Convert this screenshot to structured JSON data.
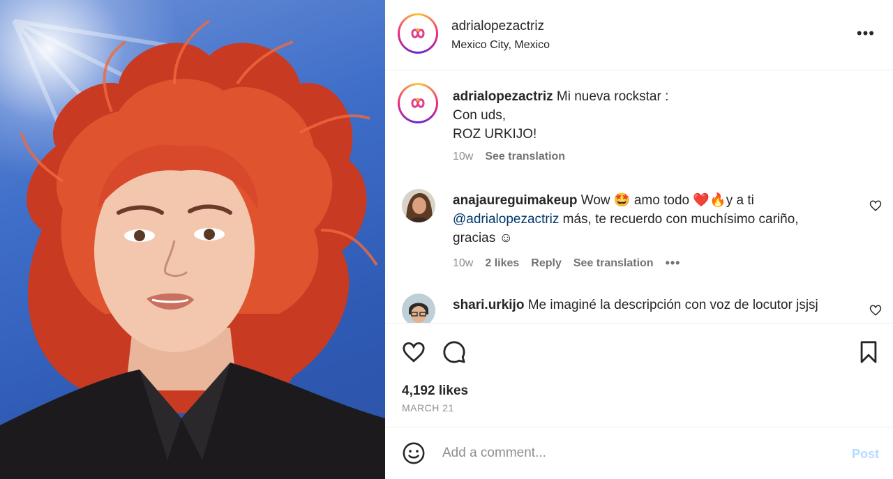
{
  "post": {
    "username": "adrialopezactriz",
    "location": "Mexico City, Mexico",
    "more_icon": "more-horizontal-icon"
  },
  "caption": {
    "username": "adrialopezactriz",
    "line1": "Mi nueva rockstar :",
    "line2": "Con uds,",
    "line3": "ROZ URKIJO!",
    "time": "10w",
    "see_translation": "See translation"
  },
  "comments": [
    {
      "username": "anajaureguimakeup",
      "text_a": "Wow",
      "emoji_a": "🤩",
      "text_b": "amo todo",
      "emoji_b": "❤️🔥",
      "text_c": "y a ti",
      "mention": "@adrialopezactriz",
      "text_d": "más, te recuerdo con muchísimo cariño,",
      "text_e": "gracias ☺",
      "time": "10w",
      "likes": "2 likes",
      "reply": "Reply",
      "see_translation": "See translation",
      "options": "•••"
    },
    {
      "username": "shari.urkijo",
      "text": "Me imaginé la descripción con voz de locutor jsjsj"
    }
  ],
  "actions": {
    "like_icon": "heart-icon",
    "comment_icon": "comment-icon",
    "save_icon": "bookmark-icon"
  },
  "likes_text": "4,192 likes",
  "date": "MARCH 21",
  "add_comment": {
    "placeholder": "Add a comment...",
    "post_label": "Post",
    "emoji_icon": "emoji-smile-icon"
  },
  "colors": {
    "link": "#00376b",
    "muted": "#8e8e8e",
    "post_disabled": "#b3dbff",
    "sky": "#2f5bb5",
    "hair": "#d9452a"
  }
}
